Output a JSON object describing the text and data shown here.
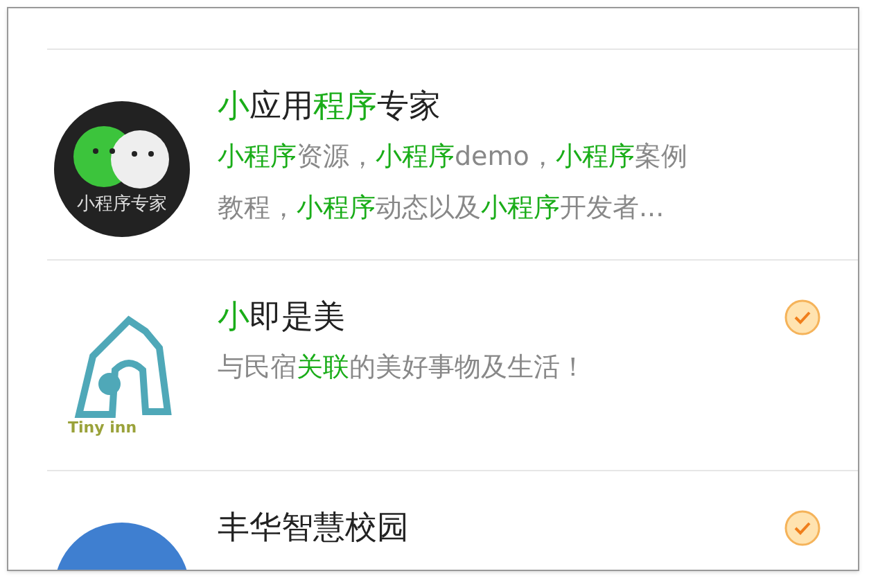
{
  "rows": [
    {
      "kind": "chat-logo",
      "avatar_text": "小程序专家",
      "verified": false,
      "title": [
        {
          "text": "小",
          "highlight": true
        },
        {
          "text": "应用",
          "highlight": false
        },
        {
          "text": "程序",
          "highlight": true
        },
        {
          "text": "专家",
          "highlight": false
        }
      ],
      "subtitle_lines": [
        [
          {
            "text": "小程序",
            "highlight": true
          },
          {
            "text": "资源，",
            "highlight": false
          },
          {
            "text": "小程序",
            "highlight": true
          },
          {
            "text": "demo，",
            "highlight": false
          },
          {
            "text": "小程序",
            "highlight": true
          },
          {
            "text": "案例",
            "highlight": false
          }
        ],
        [
          {
            "text": "教程，",
            "highlight": false
          },
          {
            "text": "小程序",
            "highlight": true
          },
          {
            "text": "动态以及",
            "highlight": false
          },
          {
            "text": "小程序",
            "highlight": true
          },
          {
            "text": "开发者...",
            "highlight": false
          }
        ]
      ]
    },
    {
      "kind": "inn-logo",
      "avatar_text": "Tiny inn",
      "verified": true,
      "title": [
        {
          "text": "小",
          "highlight": true
        },
        {
          "text": "即是美",
          "highlight": false
        }
      ],
      "subtitle_lines": [
        [
          {
            "text": "与民宿",
            "highlight": false
          },
          {
            "text": "关联",
            "highlight": true
          },
          {
            "text": "的美好事物及生活！",
            "highlight": false
          }
        ]
      ]
    },
    {
      "kind": "photo",
      "verified": true,
      "title": [
        {
          "text": "丰华智慧校园",
          "highlight": false
        }
      ],
      "subtitle_lines": []
    }
  ]
}
